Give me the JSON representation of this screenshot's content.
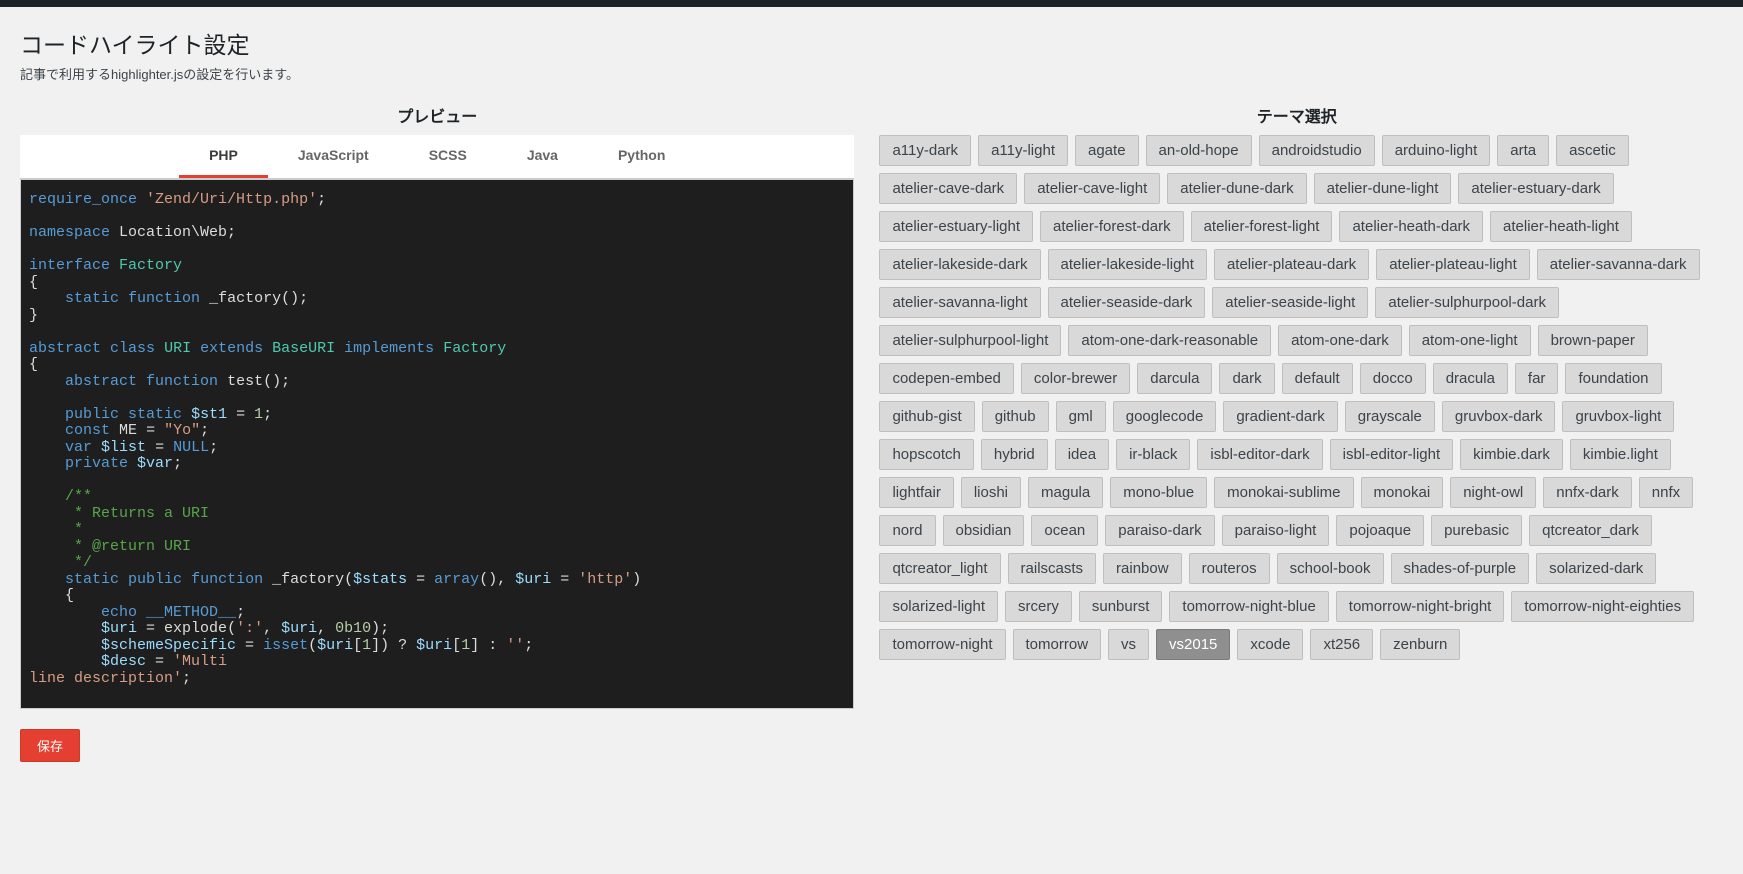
{
  "page": {
    "title": "コードハイライト設定",
    "description": "記事で利用するhighlighter.jsの設定を行います。"
  },
  "preview": {
    "heading": "プレビュー",
    "tabs": [
      {
        "label": "PHP",
        "active": true
      },
      {
        "label": "JavaScript",
        "active": false
      },
      {
        "label": "SCSS",
        "active": false
      },
      {
        "label": "Java",
        "active": false
      },
      {
        "label": "Python",
        "active": false
      }
    ],
    "code_lines": [
      [
        [
          "kw",
          "require_once"
        ],
        [
          "punc",
          " "
        ],
        [
          "str",
          "'Zend/Uri/Http.php'"
        ],
        [
          "punc",
          ";"
        ]
      ],
      [],
      [
        [
          "kw",
          "namespace"
        ],
        [
          "punc",
          " Location\\Web;"
        ]
      ],
      [],
      [
        [
          "kw",
          "interface"
        ],
        [
          "punc",
          " "
        ],
        [
          "type",
          "Factory"
        ]
      ],
      [
        [
          "punc",
          "{"
        ]
      ],
      [
        [
          "punc",
          "    "
        ],
        [
          "kw",
          "static"
        ],
        [
          "punc",
          " "
        ],
        [
          "kw",
          "function"
        ],
        [
          "punc",
          " "
        ],
        [
          "fn",
          "_factory"
        ],
        [
          "punc",
          "();"
        ]
      ],
      [
        [
          "punc",
          "}"
        ]
      ],
      [],
      [
        [
          "kw",
          "abstract"
        ],
        [
          "punc",
          " "
        ],
        [
          "kw",
          "class"
        ],
        [
          "punc",
          " "
        ],
        [
          "type",
          "URI"
        ],
        [
          "punc",
          " "
        ],
        [
          "kw",
          "extends"
        ],
        [
          "punc",
          " "
        ],
        [
          "type",
          "BaseURI"
        ],
        [
          "punc",
          " "
        ],
        [
          "kw",
          "implements"
        ],
        [
          "punc",
          " "
        ],
        [
          "type",
          "Factory"
        ]
      ],
      [
        [
          "punc",
          "{"
        ]
      ],
      [
        [
          "punc",
          "    "
        ],
        [
          "kw",
          "abstract"
        ],
        [
          "punc",
          " "
        ],
        [
          "kw",
          "function"
        ],
        [
          "punc",
          " "
        ],
        [
          "fn",
          "test"
        ],
        [
          "punc",
          "();"
        ]
      ],
      [],
      [
        [
          "punc",
          "    "
        ],
        [
          "kw",
          "public"
        ],
        [
          "punc",
          " "
        ],
        [
          "kw",
          "static"
        ],
        [
          "punc",
          " "
        ],
        [
          "var",
          "$st1"
        ],
        [
          "punc",
          " = "
        ],
        [
          "num",
          "1"
        ],
        [
          "punc",
          ";"
        ]
      ],
      [
        [
          "punc",
          "    "
        ],
        [
          "kw",
          "const"
        ],
        [
          "punc",
          " "
        ],
        [
          "const",
          "ME"
        ],
        [
          "punc",
          " = "
        ],
        [
          "str",
          "\"Yo\""
        ],
        [
          "punc",
          ";"
        ]
      ],
      [
        [
          "punc",
          "    "
        ],
        [
          "kw",
          "var"
        ],
        [
          "punc",
          " "
        ],
        [
          "var",
          "$list"
        ],
        [
          "punc",
          " = "
        ],
        [
          "builtin",
          "NULL"
        ],
        [
          "punc",
          ";"
        ]
      ],
      [
        [
          "punc",
          "    "
        ],
        [
          "kw",
          "private"
        ],
        [
          "punc",
          " "
        ],
        [
          "var",
          "$var"
        ],
        [
          "punc",
          ";"
        ]
      ],
      [],
      [
        [
          "punc",
          "    "
        ],
        [
          "comment",
          "/**"
        ]
      ],
      [
        [
          "comment",
          "     * Returns a URI"
        ]
      ],
      [
        [
          "comment",
          "     *"
        ]
      ],
      [
        [
          "comment",
          "     * @return URI"
        ]
      ],
      [
        [
          "comment",
          "     */"
        ]
      ],
      [
        [
          "punc",
          "    "
        ],
        [
          "kw",
          "static"
        ],
        [
          "punc",
          " "
        ],
        [
          "kw",
          "public"
        ],
        [
          "punc",
          " "
        ],
        [
          "kw",
          "function"
        ],
        [
          "punc",
          " "
        ],
        [
          "fn",
          "_factory"
        ],
        [
          "punc",
          "("
        ],
        [
          "var",
          "$stats"
        ],
        [
          "punc",
          " = "
        ],
        [
          "kw",
          "array"
        ],
        [
          "punc",
          "(), "
        ],
        [
          "var",
          "$uri"
        ],
        [
          "punc",
          " = "
        ],
        [
          "str",
          "'http'"
        ],
        [
          "punc",
          ")"
        ]
      ],
      [
        [
          "punc",
          "    {"
        ]
      ],
      [
        [
          "punc",
          "        "
        ],
        [
          "kw",
          "echo"
        ],
        [
          "punc",
          " "
        ],
        [
          "builtin",
          "__METHOD__"
        ],
        [
          "punc",
          ";"
        ]
      ],
      [
        [
          "punc",
          "        "
        ],
        [
          "var",
          "$uri"
        ],
        [
          "punc",
          " = "
        ],
        [
          "fn",
          "explode"
        ],
        [
          "punc",
          "("
        ],
        [
          "str",
          "':'"
        ],
        [
          "punc",
          ", "
        ],
        [
          "var",
          "$uri"
        ],
        [
          "punc",
          ", "
        ],
        [
          "num",
          "0b10"
        ],
        [
          "punc",
          ");"
        ]
      ],
      [
        [
          "punc",
          "        "
        ],
        [
          "var",
          "$schemeSpecific"
        ],
        [
          "punc",
          " = "
        ],
        [
          "kw",
          "isset"
        ],
        [
          "punc",
          "("
        ],
        [
          "var",
          "$uri"
        ],
        [
          "punc",
          "["
        ],
        [
          "num",
          "1"
        ],
        [
          "punc",
          "]) ? "
        ],
        [
          "var",
          "$uri"
        ],
        [
          "punc",
          "["
        ],
        [
          "num",
          "1"
        ],
        [
          "punc",
          "] : "
        ],
        [
          "str",
          "''"
        ],
        [
          "punc",
          ";"
        ]
      ],
      [
        [
          "punc",
          "        "
        ],
        [
          "var",
          "$desc"
        ],
        [
          "punc",
          " = "
        ],
        [
          "str",
          "'Multi"
        ]
      ],
      [
        [
          "str",
          "line description'"
        ],
        [
          "punc",
          ";"
        ]
      ]
    ]
  },
  "themes": {
    "heading": "テーマ選択",
    "selected": "vs2015",
    "list": [
      "a11y-dark",
      "a11y-light",
      "agate",
      "an-old-hope",
      "androidstudio",
      "arduino-light",
      "arta",
      "ascetic",
      "atelier-cave-dark",
      "atelier-cave-light",
      "atelier-dune-dark",
      "atelier-dune-light",
      "atelier-estuary-dark",
      "atelier-estuary-light",
      "atelier-forest-dark",
      "atelier-forest-light",
      "atelier-heath-dark",
      "atelier-heath-light",
      "atelier-lakeside-dark",
      "atelier-lakeside-light",
      "atelier-plateau-dark",
      "atelier-plateau-light",
      "atelier-savanna-dark",
      "atelier-savanna-light",
      "atelier-seaside-dark",
      "atelier-seaside-light",
      "atelier-sulphurpool-dark",
      "atelier-sulphurpool-light",
      "atom-one-dark-reasonable",
      "atom-one-dark",
      "atom-one-light",
      "brown-paper",
      "codepen-embed",
      "color-brewer",
      "darcula",
      "dark",
      "default",
      "docco",
      "dracula",
      "far",
      "foundation",
      "github-gist",
      "github",
      "gml",
      "googlecode",
      "gradient-dark",
      "grayscale",
      "gruvbox-dark",
      "gruvbox-light",
      "hopscotch",
      "hybrid",
      "idea",
      "ir-black",
      "isbl-editor-dark",
      "isbl-editor-light",
      "kimbie.dark",
      "kimbie.light",
      "lightfair",
      "lioshi",
      "magula",
      "mono-blue",
      "monokai-sublime",
      "monokai",
      "night-owl",
      "nnfx-dark",
      "nnfx",
      "nord",
      "obsidian",
      "ocean",
      "paraiso-dark",
      "paraiso-light",
      "pojoaque",
      "purebasic",
      "qtcreator_dark",
      "qtcreator_light",
      "railscasts",
      "rainbow",
      "routeros",
      "school-book",
      "shades-of-purple",
      "solarized-dark",
      "solarized-light",
      "srcery",
      "sunburst",
      "tomorrow-night-blue",
      "tomorrow-night-bright",
      "tomorrow-night-eighties",
      "tomorrow-night",
      "tomorrow",
      "vs",
      "vs2015",
      "xcode",
      "xt256",
      "zenburn"
    ]
  },
  "actions": {
    "save_label": "保存"
  }
}
